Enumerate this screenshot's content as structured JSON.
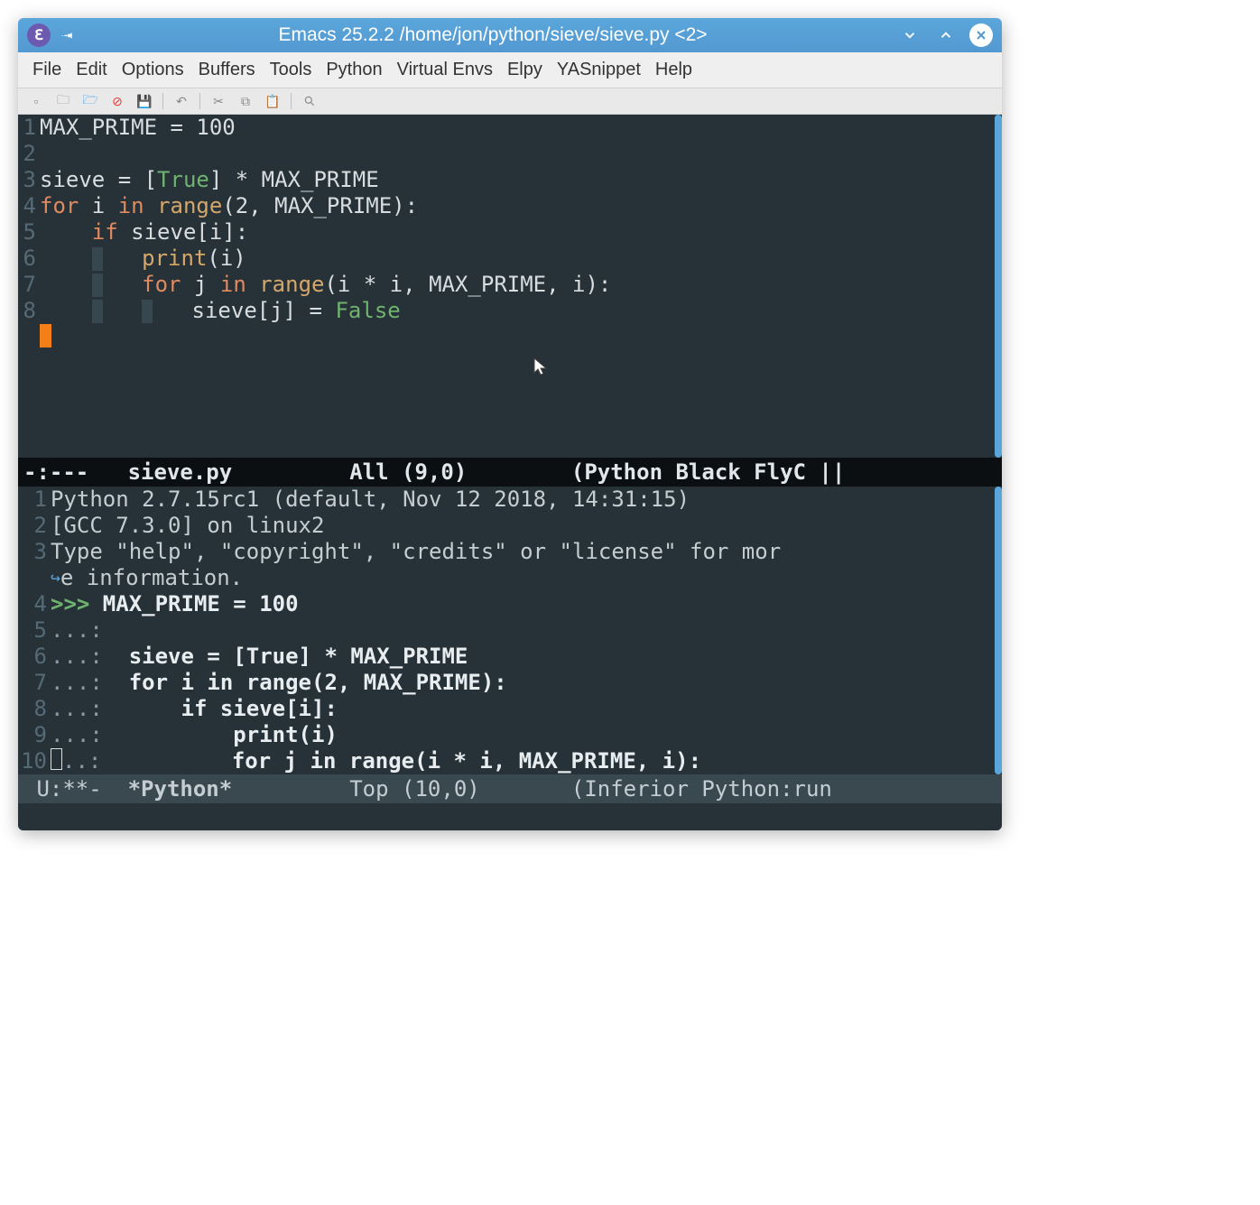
{
  "titlebar": {
    "title": "Emacs 25.2.2 /home/jon/python/sieve/sieve.py <2>"
  },
  "menubar": {
    "items": [
      "File",
      "Edit",
      "Options",
      "Buffers",
      "Tools",
      "Python",
      "Virtual Envs",
      "Elpy",
      "YASnippet",
      "Help"
    ]
  },
  "toolbar": {
    "icons": [
      "new-file",
      "open-dir",
      "open-file",
      "close",
      "save",
      "undo",
      "cut",
      "copy",
      "paste",
      "search"
    ]
  },
  "source": {
    "lines": [
      {
        "n": "1",
        "tokens": [
          {
            "t": "var",
            "v": "MAX_PRIME"
          },
          {
            "t": "plain",
            "v": " = "
          },
          {
            "t": "var",
            "v": "100"
          }
        ]
      },
      {
        "n": "2",
        "tokens": []
      },
      {
        "n": "3",
        "tokens": [
          {
            "t": "var",
            "v": "sieve"
          },
          {
            "t": "plain",
            "v": " = ["
          },
          {
            "t": "const",
            "v": "True"
          },
          {
            "t": "plain",
            "v": "] * MAX_PRIME"
          }
        ]
      },
      {
        "n": "4",
        "tokens": [
          {
            "t": "kw",
            "v": "for"
          },
          {
            "t": "plain",
            "v": " i "
          },
          {
            "t": "kw",
            "v": "in"
          },
          {
            "t": "plain",
            "v": " "
          },
          {
            "t": "builtin",
            "v": "range"
          },
          {
            "t": "plain",
            "v": "(2, MAX_PRIME):"
          }
        ]
      },
      {
        "n": "5",
        "tokens": [
          {
            "t": "sp",
            "v": "    "
          },
          {
            "t": "kw",
            "v": "if"
          },
          {
            "t": "plain",
            "v": " sieve[i]:"
          }
        ]
      },
      {
        "n": "6",
        "tokens": [
          {
            "t": "sp",
            "v": "    "
          },
          {
            "t": "guide",
            "v": ""
          },
          {
            "t": "sp",
            "v": "   "
          },
          {
            "t": "builtin",
            "v": "print"
          },
          {
            "t": "plain",
            "v": "(i)"
          }
        ]
      },
      {
        "n": "7",
        "tokens": [
          {
            "t": "sp",
            "v": "    "
          },
          {
            "t": "guide",
            "v": ""
          },
          {
            "t": "sp",
            "v": "   "
          },
          {
            "t": "kw",
            "v": "for"
          },
          {
            "t": "plain",
            "v": " j "
          },
          {
            "t": "kw",
            "v": "in"
          },
          {
            "t": "plain",
            "v": " "
          },
          {
            "t": "builtin",
            "v": "range"
          },
          {
            "t": "plain",
            "v": "(i * i, MAX_PRIME, i):"
          }
        ]
      },
      {
        "n": "8",
        "tokens": [
          {
            "t": "sp",
            "v": "    "
          },
          {
            "t": "guide",
            "v": ""
          },
          {
            "t": "sp",
            "v": "   "
          },
          {
            "t": "guide",
            "v": ""
          },
          {
            "t": "sp",
            "v": "   "
          },
          {
            "t": "plain",
            "v": "sieve[j] = "
          },
          {
            "t": "const",
            "v": "False"
          }
        ]
      }
    ]
  },
  "modeline1": {
    "left": "-:---   ",
    "buf": "sieve.py",
    "mid": "         All (9,0)        ",
    "modes": "(Python Black FlyC ||"
  },
  "repl": {
    "lines": [
      {
        "n": "1",
        "pre": "",
        "text": "Python 2.7.15rc1 (default, Nov 12 2018, 14:31:15)"
      },
      {
        "n": "2",
        "pre": "",
        "text": "[GCC 7.3.0] on linux2"
      },
      {
        "n": "3",
        "pre": "",
        "text": "Type \"help\", \"copyright\", \"credits\" or \"license\" for mor"
      },
      {
        "n": "",
        "pre": "↪",
        "text": "e information."
      },
      {
        "n": "4",
        "pre": ">>> ",
        "bold": "MAX_PRIME = 100"
      },
      {
        "n": "5",
        "pre": "...:"
      },
      {
        "n": "6",
        "pre": "...:  ",
        "bold": "sieve = [True] * MAX_PRIME"
      },
      {
        "n": "7",
        "pre": "...:  ",
        "bold": "for i in range(2, MAX_PRIME):"
      },
      {
        "n": "8",
        "pre": "...:  ",
        "bold": "    if sieve[i]:"
      },
      {
        "n": "9",
        "pre": "...:  ",
        "bold": "        print(i)"
      },
      {
        "n": "10",
        "pre": "...:  ",
        "bold": "        for j in range(i * i, MAX_PRIME, i):",
        "cursor": true
      }
    ]
  },
  "modeline2": {
    "left": " U:**-  ",
    "buf": "*Python*",
    "mid": "         Top (10,0)       ",
    "modes": "(Inferior Python:run "
  }
}
